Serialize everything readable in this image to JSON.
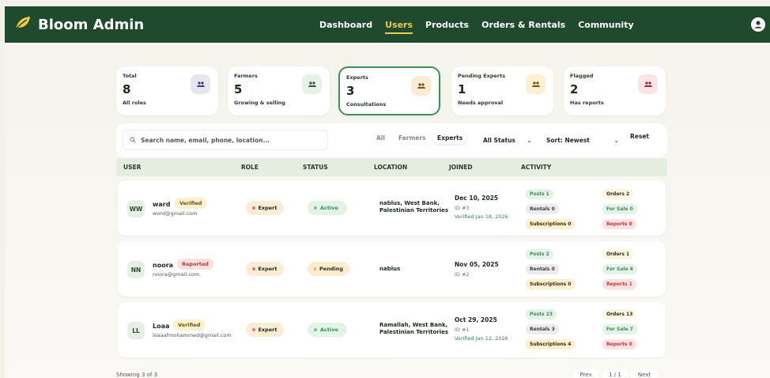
{
  "app": {
    "title": "Bloom Admin",
    "brand_color": "#1f4a2e",
    "accent": "#f0c94b"
  },
  "nav": [
    {
      "label": "Dashboard",
      "active": false
    },
    {
      "label": "Users",
      "active": true
    },
    {
      "label": "Products",
      "active": false
    },
    {
      "label": "Orders & Rentals",
      "active": false
    },
    {
      "label": "Community",
      "active": false
    }
  ],
  "stats": [
    {
      "label": "Total",
      "value": "8",
      "sub": "All roles",
      "icon": "users-icon"
    },
    {
      "label": "Farmers",
      "value": "5",
      "sub": "Growing & selling",
      "icon": "users-icon"
    },
    {
      "label": "Experts",
      "value": "3",
      "sub": "Consultations",
      "icon": "users-icon",
      "selected": true
    },
    {
      "label": "Pending Experts",
      "value": "1",
      "sub": "Needs approval",
      "icon": "users-icon"
    },
    {
      "label": "Flagged",
      "value": "2",
      "sub": "Has reports",
      "icon": "users-icon"
    }
  ],
  "filters": {
    "search_placeholder": "Search name, email, phone, location...",
    "segments": [
      "All",
      "Farmers",
      "Experts"
    ],
    "active_segment": "Experts",
    "status_value": "All Status",
    "sort_value": "Sort: Newest",
    "reset_label": "Reset"
  },
  "table": {
    "headers": [
      "USER",
      "ROLE",
      "STATUS",
      "LOCATION",
      "JOINED",
      "ACTIVITY"
    ],
    "rows": [
      {
        "initials": "WW",
        "name": "ward",
        "badge": "Verified",
        "email": "word@gmail.com",
        "role": "Expert",
        "status": "Active",
        "location_line1": "nablus, West Bank,",
        "location_line2": "Palestinian Territories",
        "joined": "Dec 10, 2025",
        "id": "ID #3",
        "verified": "Verified Jan 18, 2026",
        "posts": "Posts 1",
        "rentals": "Rentals 0",
        "subs": "Subscriptions 0",
        "orders": "Orders 2",
        "forsale": "For Sale 0",
        "reports": "Reports 0"
      },
      {
        "initials": "NN",
        "name": "noora",
        "badge": "Reported",
        "email": "noora@gmail.com",
        "role": "Expert",
        "status": "Pending",
        "location_line1": "nablus",
        "location_line2": "",
        "joined": "Nov 05, 2025",
        "id": "ID #2",
        "verified": "",
        "posts": "Posts 2",
        "rentals": "Rentals 0",
        "subs": "Subscriptions 0",
        "orders": "Orders 1",
        "forsale": "For Sale 4",
        "reports": "Reports 1"
      },
      {
        "initials": "LL",
        "name": "Loaa",
        "badge": "Verified",
        "email": "loaaafmohammed@gmail.com",
        "role": "Expert",
        "status": "Active",
        "location_line1": "Ramallah, West Bank,",
        "location_line2": "Palestinian Territories",
        "joined": "Oct 29, 2025",
        "id": "ID #1",
        "verified": "Verified Jan 12, 2026",
        "posts": "Posts 23",
        "rentals": "Rentals 3",
        "subs": "Subscriptions 4",
        "orders": "Orders 13",
        "forsale": "For Sale 7",
        "reports": "Reports 0"
      }
    ]
  },
  "footer": {
    "showing": "Showing 3 of 3",
    "prev": "Prev",
    "page": "1 / 1",
    "next": "Next"
  }
}
